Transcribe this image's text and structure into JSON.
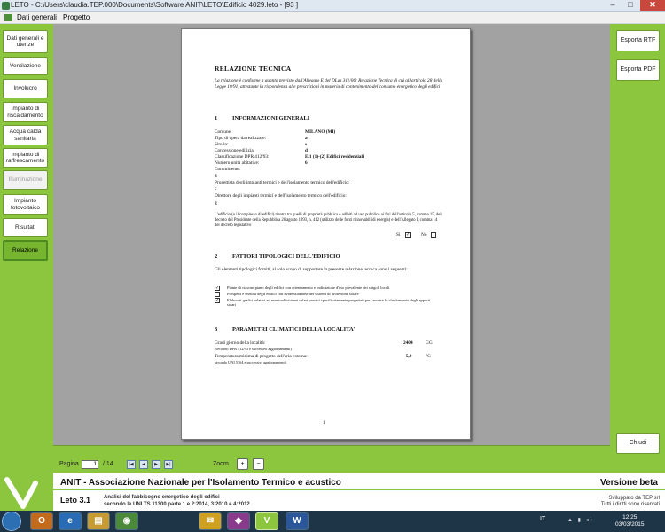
{
  "window": {
    "title": "LETO - C:\\Users\\claudia.TEP.000\\Documents\\Software ANIT\\LETO\\Edificio 4029.leto - [93 ]",
    "min": "–",
    "max": "□",
    "close": "✕"
  },
  "menu": {
    "items": [
      "Dati generali",
      "Progetto"
    ]
  },
  "sidebar": {
    "items": [
      {
        "label": "Dati generali e utenze",
        "state": "normal"
      },
      {
        "label": "Ventilazione",
        "state": "normal"
      },
      {
        "label": "Involucro",
        "state": "normal"
      },
      {
        "label": "Impianto di riscaldamento",
        "state": "normal"
      },
      {
        "label": "Acqua calda sanitaria",
        "state": "normal"
      },
      {
        "label": "Impianto di raffrescamento",
        "state": "normal"
      },
      {
        "label": "Illuminazione",
        "state": "disabled"
      },
      {
        "label": "Impianto fotovoltaico",
        "state": "normal"
      },
      {
        "label": "Risultati",
        "state": "normal"
      },
      {
        "label": "Relazione",
        "state": "active"
      }
    ]
  },
  "document": {
    "title": "RELAZIONE TECNICA",
    "intro": "La relazione è conforme a quanto previsto dall'Allegato E del DLgs 311/06: Relazione Tecnica di cui all'articolo 28 della Legge 10/91, attestante la rispondenza alle prescrizioni in materia di contenimento del consumo energetico degli edifici",
    "sec1": {
      "num": "1",
      "title": "INFORMAZIONI GENERALI"
    },
    "fields": {
      "comune": {
        "label": "Comune:",
        "value": "MILANO (MI)"
      },
      "tipo": {
        "label": "Tipo di opera da realizzare:",
        "value": "a"
      },
      "sito": {
        "label": "Sito in:",
        "value": "s"
      },
      "concessione": {
        "label": "Concessione edilizia:",
        "value": "d"
      },
      "classificazione": {
        "label": "Classificazione DPR 412/93:",
        "value": "E.1 (1)-(2) Edifici residenziali"
      },
      "unita": {
        "label": "Numero unità abitative:",
        "value": "6"
      },
      "committente": {
        "label": "Committente:",
        "value": "g"
      },
      "progettista": {
        "label": "Progettista degli impianti termici e dell'isolamento termico dell'edificio:",
        "value": "c"
      },
      "direttore": {
        "label": "Direttore degli impianti termici e dell'isolamento termico dell'edificio:",
        "value": "g"
      }
    },
    "public_text": "L'edificio (o il complesso di edifici) rientra tra quelli di proprietà pubblica o adibiti ad uso pubblico ai fini dell'articolo 5, comma 15, del decreto del Presidente della Repubblica 26 agosto 1993, n. 412 (utilizzo delle fonti rinnovabili di energia) e dell'Allegato I, comma 14 del decreto legislativo",
    "si_label": "Si",
    "si_mark": "✓",
    "no_label": "No",
    "no_mark": "",
    "sec2": {
      "num": "2",
      "title": "FATTORI TIPOLOGICI DELL'EDIFICIO"
    },
    "sec2_text": "Gli elementi tipologici forniti, al solo scopo di supportare la presente relazione tecnica sono i seguenti:",
    "checklist": [
      {
        "mark": "✓",
        "text": "Piante di ciascun piano degli edifici con orientamento e indicazione d'uso prevalente dei singoli locali"
      },
      {
        "mark": "",
        "text": "Prospetti e sezioni degli edifici con evidenziazione dei sistemi di protezione solare"
      },
      {
        "mark": "✓",
        "text": "Elaborati grafici relativi ad eventuali sistemi solari passivi specificatamente progettati per favorire lo sfruttamento degli apporti solari"
      }
    ],
    "sec3": {
      "num": "3",
      "title": "PARAMETRI CLIMATICI DELLA LOCALITA'"
    },
    "climate": [
      {
        "label": "Gradi giorno della località:",
        "sub": "(secondo DPR 412/93 e successivi aggiornamenti)",
        "value": "2404",
        "unit": "GG"
      },
      {
        "label": "Temperatura minima di progetto dell'aria esterna:",
        "sub": "secondo UNI 5364 e successivi aggiornamenti)",
        "value": "-5,0",
        "unit": "°C"
      }
    ],
    "page_number": "1"
  },
  "right": {
    "export_rtf": "Esporta RTF",
    "export_pdf": "Esporta PDF",
    "close": "Chiudi"
  },
  "pager": {
    "label": "Pagina",
    "current": "1",
    "total": "/ 14",
    "first": "|◀",
    "prev": "◀",
    "next": "▶",
    "last": "▶|",
    "zoom_label": "Zoom",
    "zoom_in": "+",
    "zoom_out": "−"
  },
  "footer": {
    "org": "ANIT - Associazione Nazionale per l'Isolamento Termico e acustico",
    "beta": "Versione beta",
    "version": "Leto 3.1",
    "desc1": "Analisi del fabbisogno energetico degli edifici",
    "desc2": "secondo le UNI TS 11300 parte 1 e 2:2014, 3:2010 e 4:2012",
    "dev1": "Sviluppato da TEP srl",
    "dev2": "Tutti i diritti sono riservati"
  },
  "taskbar": {
    "apps": [
      "O",
      "e",
      "▤",
      "◉",
      "✉",
      "◆",
      "V",
      "W"
    ],
    "lang": "IT",
    "time": "12:25",
    "date": "03/03/2015"
  },
  "colors": {
    "accent_green": "#8cc63f",
    "preview_gray": "#a2a2a2",
    "taskbar": "#1e3548"
  }
}
